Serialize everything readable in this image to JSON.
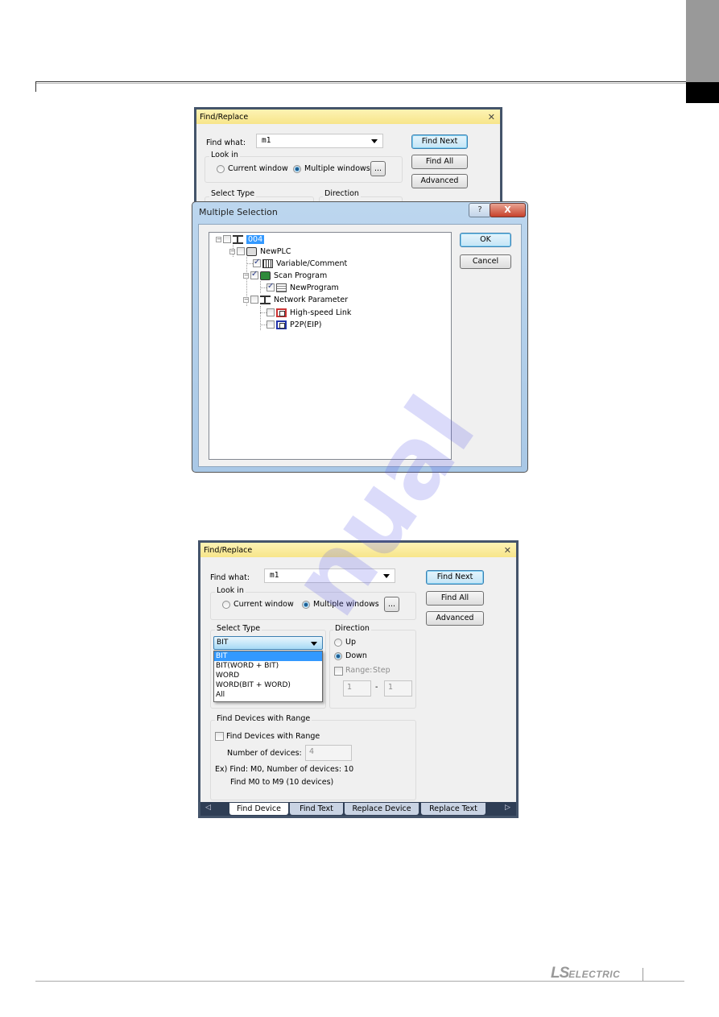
{
  "find_replace_top": {
    "title": "Find/Replace",
    "find_what_label": "Find what:",
    "find_what_value": "m1",
    "look_in_label": "Look in",
    "radio_current": "Current window",
    "radio_multiple": "Multiple windows",
    "look_in_selected": "Multiple windows",
    "browse_label": "...",
    "buttons": {
      "find_next": "Find Next",
      "find_all": "Find All",
      "advanced": "Advanced"
    },
    "select_type_label": "Select Type",
    "direction_label": "Direction"
  },
  "multiple_selection": {
    "title": "Multiple Selection",
    "help_label": "?",
    "close_label": "X",
    "ok_label": "OK",
    "cancel_label": "Cancel",
    "tree": [
      {
        "label": "004",
        "checked": false,
        "icon": "network-icon",
        "selected": true
      },
      {
        "label": "NewPLC",
        "checked": false,
        "icon": "plc-icon"
      },
      {
        "label": "Variable/Comment",
        "checked": true,
        "icon": "variable-comment-icon"
      },
      {
        "label": "Scan Program",
        "checked": true,
        "icon": "scan-program-icon"
      },
      {
        "label": "NewProgram",
        "checked": true,
        "icon": "program-icon"
      },
      {
        "label": "Network Parameter",
        "checked": false,
        "icon": "network-icon"
      },
      {
        "label": "High-speed Link",
        "checked": false,
        "icon": "high-speed-link-icon"
      },
      {
        "label": "P2P(EIP)",
        "checked": false,
        "icon": "p2p-icon"
      }
    ]
  },
  "find_replace_bottom": {
    "title": "Find/Replace",
    "close_label": "X",
    "find_what_label": "Find what:",
    "find_what_value": "m1",
    "look_in_label": "Look in",
    "radio_current": "Current window",
    "radio_multiple": "Multiple windows",
    "look_in_selected": "Multiple windows",
    "browse_label": "...",
    "buttons": {
      "find_next": "Find Next",
      "find_all": "Find All",
      "advanced": "Advanced"
    },
    "select_type": {
      "label": "Select Type",
      "value": "BIT",
      "options": [
        "BIT",
        "BIT(WORD + BIT)",
        "WORD",
        "WORD(BIT + WORD)",
        "All"
      ],
      "highlighted": "BIT"
    },
    "direction": {
      "label": "Direction",
      "up": "Up",
      "down": "Down",
      "selected": "Down",
      "range_label": "Range:",
      "step_label": "Step",
      "range_checked": false,
      "range_from": "1",
      "range_sep": "-",
      "range_to": "1"
    },
    "find_devices_range": {
      "group_label": "Find Devices with Range",
      "checkbox_label": "Find Devices with Range",
      "checked": false,
      "num_devices_label": "Number of devices:",
      "num_devices_value": "4",
      "example_line1": "Ex) Find: M0, Number of devices: 10",
      "example_line2": "Find M0 to M9 (10 devices)"
    },
    "tabs": [
      {
        "label": "Find Device",
        "active": true
      },
      {
        "label": "Find Text",
        "active": false
      },
      {
        "label": "Replace Device",
        "active": false
      },
      {
        "label": "Replace Text",
        "active": false
      }
    ]
  },
  "footer": {
    "logo_ls": "LS",
    "logo_electric": "ELECTRIC"
  }
}
